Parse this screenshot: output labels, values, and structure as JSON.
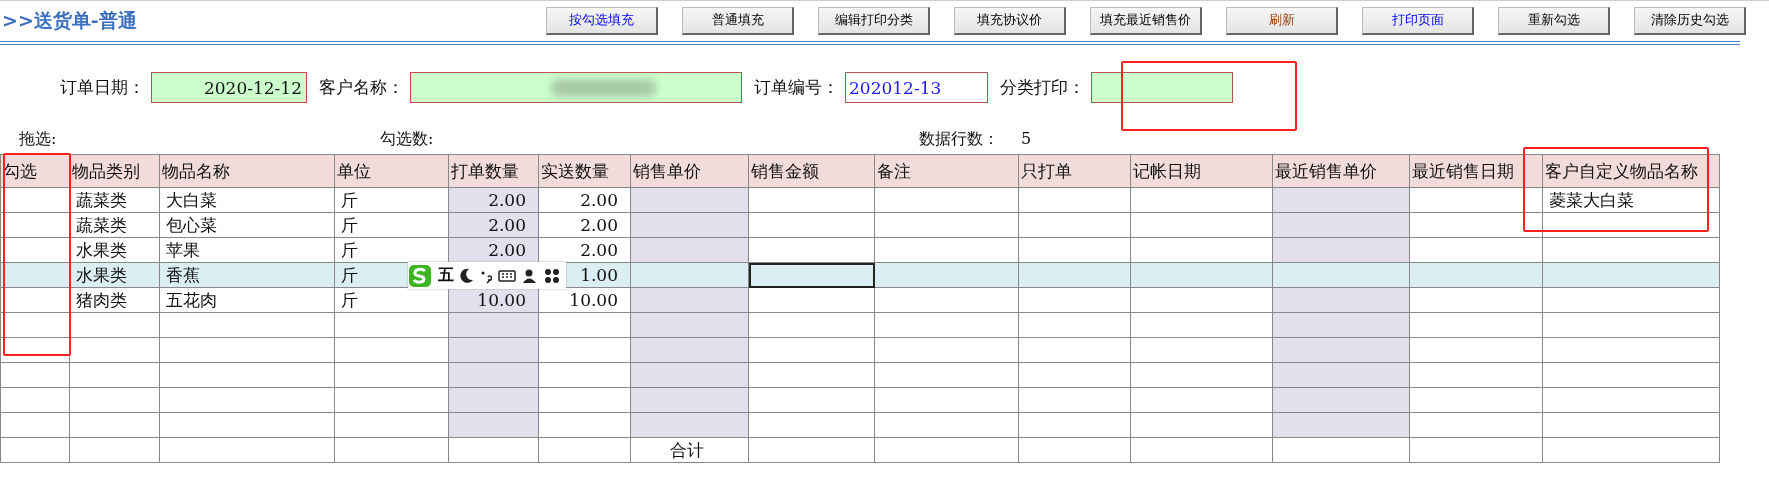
{
  "title": ">>送货单-普通",
  "buttons": [
    {
      "label": "按勾选填充",
      "kind": "blue"
    },
    {
      "label": "普通填充",
      "kind": "normal"
    },
    {
      "label": "编辑打印分类",
      "kind": "normal"
    },
    {
      "label": "填充协议价",
      "kind": "normal"
    },
    {
      "label": "填充最近销售价",
      "kind": "normal"
    },
    {
      "label": "刷新",
      "kind": "warning"
    },
    {
      "label": "打印页面",
      "kind": "blue"
    },
    {
      "label": "重新勾选",
      "kind": "normal"
    },
    {
      "label": "清除历史勾选",
      "kind": "normal"
    }
  ],
  "fields": [
    {
      "label": "订单日期：",
      "value": "2020-12-12",
      "highlighted": true,
      "blurred": false
    },
    {
      "label": "客户名称：",
      "highlighted": true,
      "blurred": true
    },
    {
      "label": "订单编号：",
      "value": "202012-13",
      "highlighted": false,
      "blurred": false
    },
    {
      "label": "分类打印：",
      "highlighted": true,
      "blurred": false
    }
  ],
  "stats": {
    "drag_label": "拖选:",
    "checked_count_label": "勾选数:",
    "row_count_label": "数据行数：",
    "row_count": "5"
  },
  "table": {
    "columns": [
      {
        "label": "勾选",
        "kind": "text",
        "shaded": false,
        "cursor": false
      },
      {
        "label": "物品类别",
        "kind": "text",
        "shaded": false,
        "cursor": false
      },
      {
        "label": "物品名称",
        "kind": "text",
        "shaded": false,
        "cursor": false
      },
      {
        "label": "单位",
        "kind": "text",
        "shaded": false,
        "cursor": false
      },
      {
        "label": "打单数量",
        "kind": "number",
        "shaded": true,
        "cursor": false
      },
      {
        "label": "实送数量",
        "kind": "number",
        "shaded": false,
        "cursor": false
      },
      {
        "label": "销售单价",
        "kind": "number",
        "shaded": true,
        "cursor": false
      },
      {
        "label": "销售金额",
        "kind": "number",
        "shaded": false,
        "cursor": true
      },
      {
        "label": "备注",
        "kind": "text",
        "shaded": false,
        "cursor": false
      },
      {
        "label": "只打单",
        "kind": "text",
        "shaded": false,
        "cursor": false
      },
      {
        "label": "记帐日期",
        "kind": "text",
        "shaded": false,
        "cursor": false
      },
      {
        "label": "最近销售单价",
        "kind": "number",
        "shaded": true,
        "cursor": false
      },
      {
        "label": "最近销售日期",
        "kind": "text",
        "shaded": false,
        "cursor": false
      },
      {
        "label": "客户自定义物品名称",
        "kind": "text",
        "shaded": false,
        "cursor": false
      }
    ],
    "rows": [
      {
        "kind": "data",
        "selected": false,
        "cells": [
          null,
          "蔬菜类",
          "大白菜",
          "斤",
          "2.00",
          "2.00",
          null,
          null,
          null,
          null,
          null,
          null,
          null,
          "菱菜大白菜"
        ]
      },
      {
        "kind": "data",
        "selected": false,
        "cells": [
          null,
          "蔬菜类",
          "包心菜",
          "斤",
          "2.00",
          "2.00"
        ]
      },
      {
        "kind": "data",
        "selected": false,
        "cells": [
          null,
          "水果类",
          "苹果",
          "斤",
          "2.00",
          "2.00"
        ]
      },
      {
        "kind": "data",
        "selected": true,
        "cells": [
          null,
          "水果类",
          "香蕉",
          "斤",
          null,
          "1.00"
        ]
      },
      {
        "kind": "data",
        "selected": false,
        "cells": [
          null,
          "猪肉类",
          "五花肉",
          "斤",
          "10.00",
          "10.00"
        ]
      },
      {
        "kind": "data",
        "selected": false
      },
      {
        "kind": "data",
        "selected": false
      },
      {
        "kind": "data",
        "selected": false
      },
      {
        "kind": "data",
        "selected": false
      },
      {
        "kind": "data",
        "selected": false
      },
      {
        "kind": "total",
        "selected": false,
        "cells": [
          null,
          null,
          null,
          null,
          null,
          null,
          "合计"
        ]
      }
    ]
  },
  "ime_toolbar": {
    "mode": "五"
  }
}
